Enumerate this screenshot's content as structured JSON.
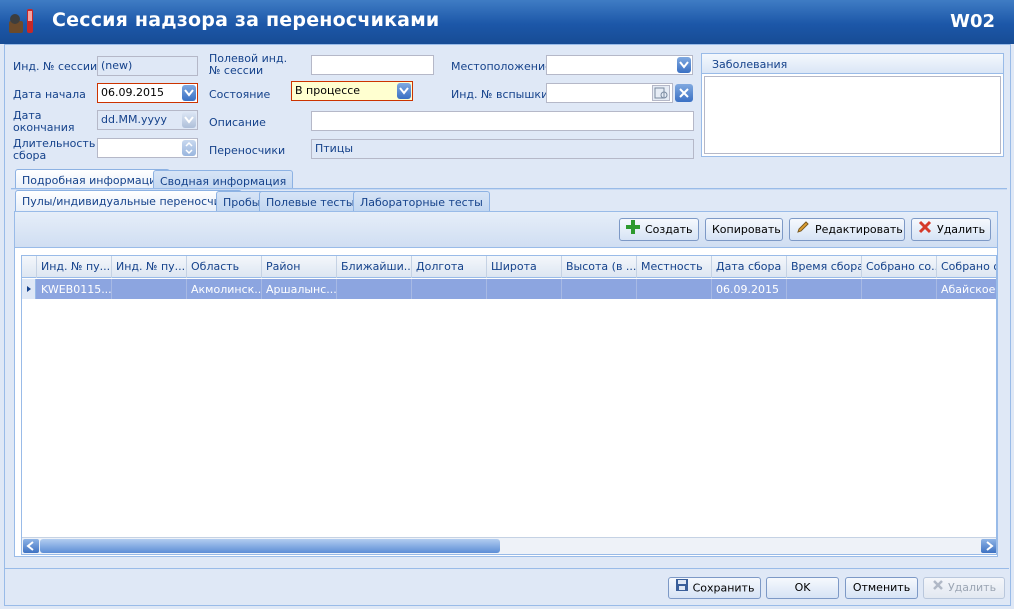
{
  "window": {
    "title": "Сессия надзора за переносчиками",
    "code": "W02"
  },
  "form": {
    "session_id": {
      "label": "Инд. № сессии",
      "value": "(new)"
    },
    "start_date": {
      "label": "Дата начала",
      "value": "06.09.2015"
    },
    "end_date": {
      "label": "Дата окончания",
      "value": "dd.MM.yyyy"
    },
    "duration": {
      "label": "Длительность сбора",
      "value": ""
    },
    "field_session_id": {
      "label": "Полевой инд. № сессии",
      "value": ""
    },
    "state": {
      "label": "Состояние",
      "value": "В процессе"
    },
    "description": {
      "label": "Описание",
      "value": ""
    },
    "vectors": {
      "label": "Переносчики",
      "value": "Птицы"
    },
    "location": {
      "label": "Местоположение",
      "value": ""
    },
    "outbreak_id": {
      "label": "Инд. № вспышки",
      "value": ""
    },
    "diseases": {
      "label": "Заболевания"
    }
  },
  "tabs": {
    "outer": [
      "Подробная информация",
      "Сводная информация"
    ],
    "inner": [
      "Пулы/индивидуальные переносчики",
      "Пробы",
      "Полевые тесты",
      "Лабораторные тесты"
    ]
  },
  "toolbar": {
    "create": "Создать",
    "copy": "Копировать",
    "edit": "Редактировать",
    "delete": "Удалить"
  },
  "grid": {
    "columns": [
      "Инд. № пу...",
      "Инд. № пу...",
      "Область",
      "Район",
      "Ближайши...",
      "Долгота",
      "Широта",
      "Высота (в ...",
      "Местность",
      "Дата сбора",
      "Время сбора",
      "Собрано со...",
      "Собрано ор"
    ],
    "rows": [
      [
        "KWEB0115...",
        "",
        "Акмолинск...",
        "Аршалынс...",
        "",
        "",
        "",
        "",
        "",
        "06.09.2015",
        "",
        "",
        "Абайское р"
      ]
    ]
  },
  "footer": {
    "save": "Сохранить",
    "ok": "OK",
    "cancel": "Отменить",
    "delete": "Удалить"
  }
}
